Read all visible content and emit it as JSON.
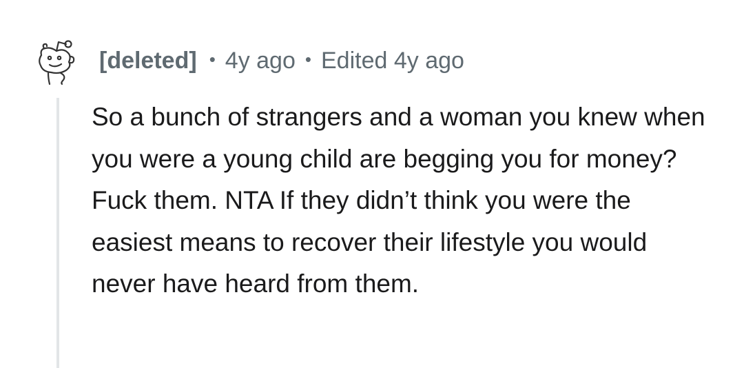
{
  "comment": {
    "author": "[deleted]",
    "age": "4y ago",
    "edited": "Edited 4y ago",
    "separator": "•",
    "body": "So a bunch of strangers and a woman you knew when you were a young child are begging you for money? Fuck them. NTA If they didn’t think you were the easiest means to recover their lifestyle you would never have heard from them.",
    "avatar_icon": "snoo-avatar-icon"
  },
  "colors": {
    "meta_text": "#5f6a71",
    "body_text": "#1a1a1b",
    "thread_line": "#e2e5e7",
    "background": "#ffffff"
  }
}
